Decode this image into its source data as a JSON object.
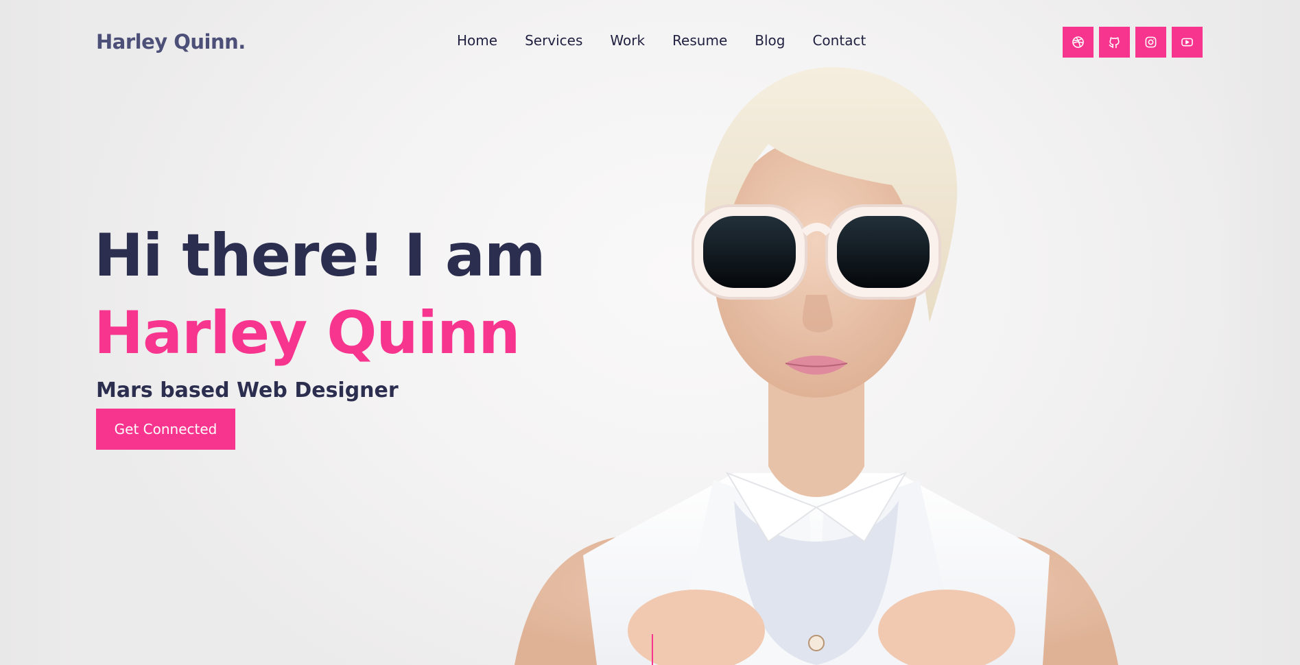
{
  "brand": {
    "logo": "Harley Quinn."
  },
  "nav": {
    "items": [
      {
        "label": "Home"
      },
      {
        "label": "Services"
      },
      {
        "label": "Work"
      },
      {
        "label": "Resume"
      },
      {
        "label": "Blog"
      },
      {
        "label": "Contact"
      }
    ]
  },
  "socials": [
    {
      "icon": "dribbble-icon"
    },
    {
      "icon": "github-icon"
    },
    {
      "icon": "instagram-icon"
    },
    {
      "icon": "youtube-icon"
    }
  ],
  "hero": {
    "greeting": "Hi there! I am",
    "name": "Harley Quinn",
    "tagline": "Mars based Web Designer",
    "cta_label": "Get Connected"
  },
  "colors": {
    "accent": "#f7358f",
    "heading": "#2c2e50",
    "logo": "#4c4f77",
    "background": "#f2f1f1"
  }
}
